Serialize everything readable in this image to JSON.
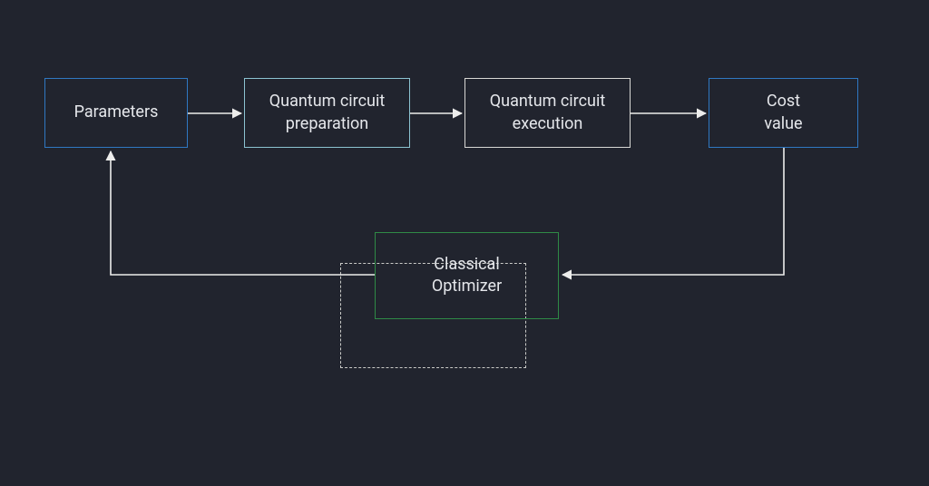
{
  "colors": {
    "background": "#21242E",
    "text": "#E5E7EB",
    "stroke_blue": "#2F78C2",
    "stroke_lightblue": "#8CC3D1",
    "stroke_white": "#D8D8D5",
    "stroke_green": "#2F8A46",
    "arrow": "#EDEDEC",
    "dashed": "#C9CAC7"
  },
  "nodes": {
    "parameters": {
      "label": "Parameters",
      "stroke": "blue"
    },
    "prep": {
      "label": "Quantum circuit\npreparation",
      "stroke": "lightblue"
    },
    "exec": {
      "label": "Quantum circuit\nexecution",
      "stroke": "white"
    },
    "cost": {
      "label": "Cost\nvalue",
      "stroke": "blue"
    },
    "optimizer": {
      "label": "Classical\nOptimizer",
      "stroke": "green"
    }
  },
  "edges": [
    {
      "from": "parameters",
      "to": "prep"
    },
    {
      "from": "prep",
      "to": "exec"
    },
    {
      "from": "exec",
      "to": "cost"
    },
    {
      "from": "cost",
      "to": "optimizer"
    },
    {
      "from": "optimizer",
      "to": "parameters"
    }
  ]
}
